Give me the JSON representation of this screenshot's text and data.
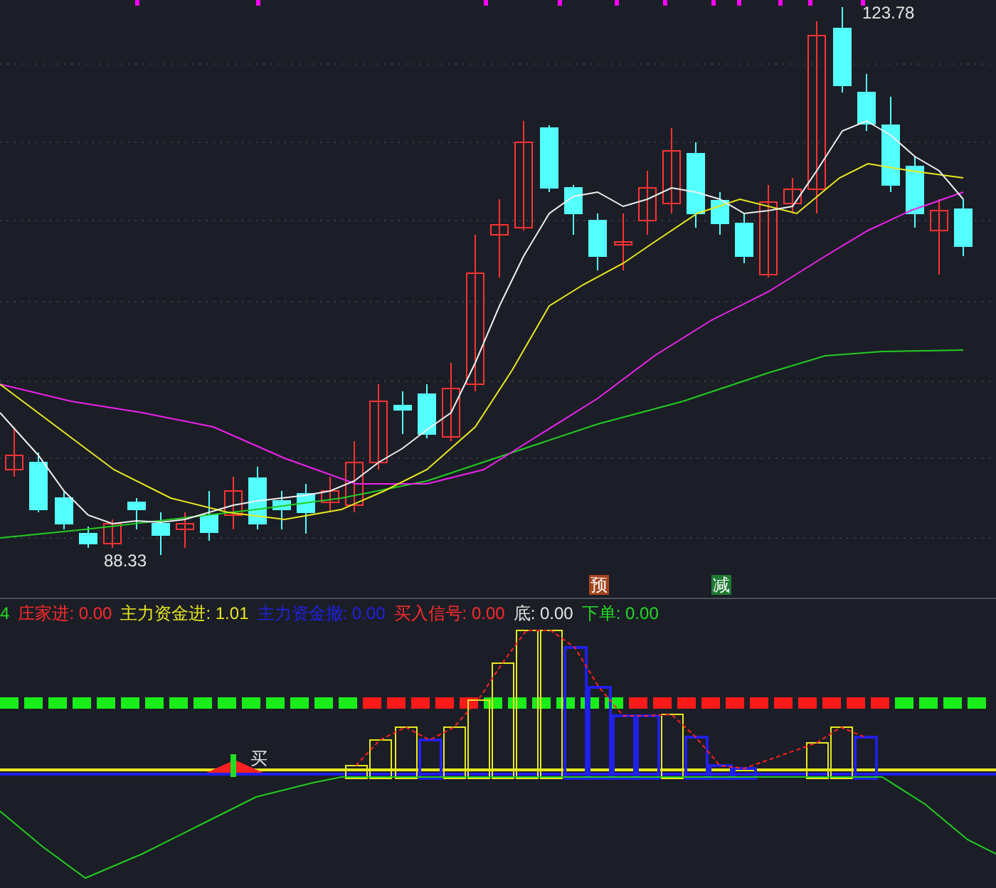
{
  "price_chart": {
    "high_label": "123.78",
    "low_label": "88.33"
  },
  "signal_markers": [
    {
      "text": "预",
      "color": "#a3441d"
    },
    {
      "text": "减",
      "color": "#1e7a33"
    }
  ],
  "indicator_legend": [
    {
      "value": "4",
      "color": "#22dd22"
    },
    {
      "name": "庄家进:",
      "value": "0.00",
      "color": "#ff2a2a"
    },
    {
      "name": "主力资金进:",
      "value": "1.01",
      "color": "#e8e81e"
    },
    {
      "name": "主力资金撤:",
      "value": "0.00",
      "color": "#2020e8"
    },
    {
      "name": "买入信号:",
      "value": "0.00",
      "color": "#ff2a2a"
    },
    {
      "name": "底:",
      "value": "0.00",
      "color": "#e6e6e6"
    },
    {
      "name": "下单:",
      "value": "0.00",
      "color": "#22dd22"
    }
  ],
  "indicator_chart": {
    "buy_label": "买"
  }
}
